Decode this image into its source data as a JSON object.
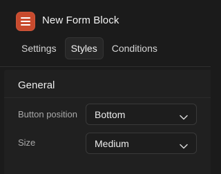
{
  "header": {
    "title": "New Form Block",
    "icon": "menu-icon",
    "icon_color": "#c84a2d"
  },
  "tabs": [
    {
      "label": "Settings",
      "active": false
    },
    {
      "label": "Styles",
      "active": true
    },
    {
      "label": "Conditions",
      "active": false
    }
  ],
  "section": {
    "title": "General",
    "fields": [
      {
        "label": "Button position",
        "value": "Bottom",
        "icon": "chevron-down-icon"
      },
      {
        "label": "Size",
        "value": "Medium",
        "icon": "chevron-down-icon"
      }
    ]
  }
}
